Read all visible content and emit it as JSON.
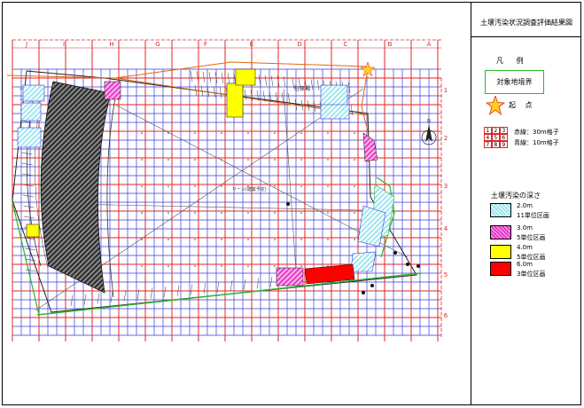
{
  "title": "土壌汚染状況調査評価結果図",
  "legend": {
    "heading": "凡 例",
    "boundary_label": "対象地境界",
    "start_label": "起 点",
    "grid_numbers": [
      "1",
      "2",
      "3",
      "4",
      "5",
      "6",
      "7",
      "8",
      "9"
    ],
    "red_grid_label": "赤線：30m格子",
    "blue_grid_label": "青線：10m格子",
    "depth_heading": "土壌汚染の深さ",
    "depths": [
      {
        "value": "2.0m",
        "count": "11単位区画",
        "color": "#9ee6f0"
      },
      {
        "value": "3.0m",
        "count": "5単位区画",
        "color": "#e83ac8"
      },
      {
        "value": "4.0m",
        "count": "5単位区画",
        "color": "#ffff00"
      },
      {
        "value": "6.0m",
        "count": "3単位区画",
        "color": "#ff0000"
      }
    ]
  },
  "map": {
    "column_labels": [
      "J",
      "I",
      "H",
      "G",
      "F",
      "E",
      "D",
      "C",
      "B",
      "A"
    ],
    "row_labels": [
      "1",
      "2",
      "3",
      "4",
      "5",
      "6"
    ],
    "building_label": "駐車場",
    "center_label": "リーン(建築予定)",
    "north_label": "N"
  },
  "colors": {
    "red_grid": "#e0262a",
    "blue_grid": "#3a3ad8",
    "boundary": "#2bb52b",
    "road": "#e06a10",
    "cyan": "#9ee6f0",
    "magenta": "#e83ac8",
    "yellow": "#ffff00",
    "red": "#ff0000"
  }
}
